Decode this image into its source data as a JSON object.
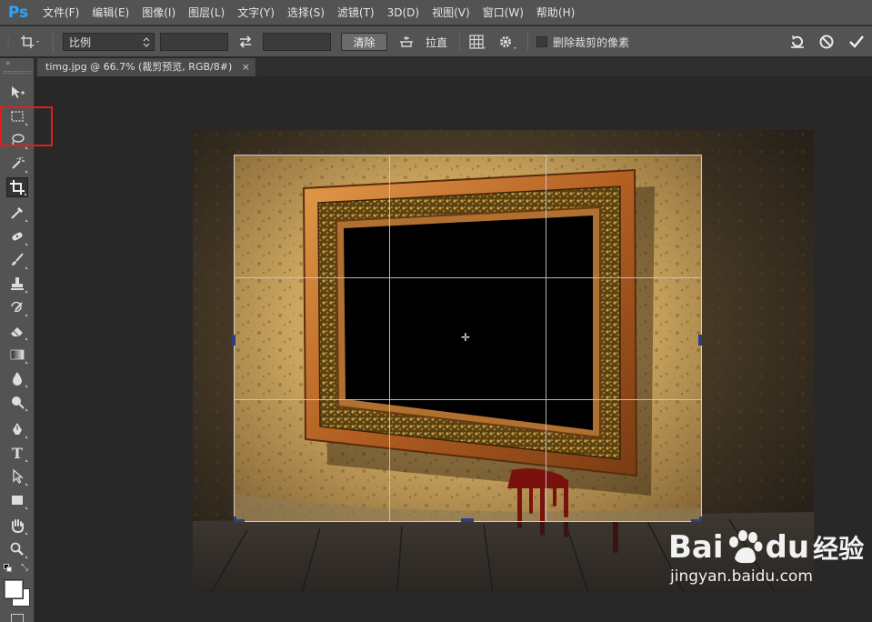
{
  "app": {
    "logo": "Ps"
  },
  "menu": [
    "文件(F)",
    "编辑(E)",
    "图像(I)",
    "图层(L)",
    "文字(Y)",
    "选择(S)",
    "滤镜(T)",
    "3D(D)",
    "视图(V)",
    "窗口(W)",
    "帮助(H)"
  ],
  "options": {
    "ratio_select": "比例",
    "width_value": "",
    "height_value": "",
    "clear_button": "清除",
    "straighten_label": "拉直",
    "delete_cropped_label": "删除裁剪的像素",
    "delete_cropped_checked": false
  },
  "document": {
    "tab_title": "timg.jpg @ 66.7% (裁剪预览, RGB/8#)",
    "close_glyph": "×"
  },
  "tools": [
    "move-tool",
    "marquee-tool",
    "lasso-tool",
    "quick-selection-tool",
    "crop-tool",
    "eyedropper-tool",
    "healing-brush-tool",
    "brush-tool",
    "clone-stamp-tool",
    "history-brush-tool",
    "eraser-tool",
    "gradient-tool",
    "blur-tool",
    "dodge-tool",
    "pen-tool",
    "type-tool",
    "path-selection-tool",
    "rectangle-tool",
    "hand-tool",
    "zoom-tool"
  ],
  "active_tool": "crop-tool",
  "type_tool_glyph": "T",
  "watermark": {
    "logo_text_1": "Bai",
    "logo_text_2": "du",
    "logo_text_3": "经验",
    "url": "jingyan.baidu.com"
  }
}
